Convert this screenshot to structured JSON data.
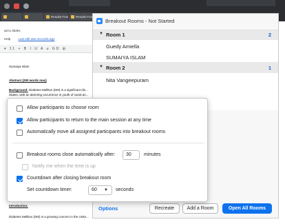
{
  "browser": {
    "top_tabs": [
      "",
      ""
    ],
    "tabs": [
      "",
      "",
      "Results From a T...",
      "Results From a T..."
    ]
  },
  "doc": {
    "link_text": "ad to Slides",
    "menu": [
      "Help"
    ],
    "last_edit": "Last edit was seconds ago",
    "toolbar": "▾ 11 + B I U A ⌀ GD ⊞",
    "author": "Sumaiya Islam",
    "abstract_heading": "Abstract (250 words max)",
    "background_label": "Background:",
    "background_text": " Diabetes Mellitus (DM) is a significant dis... States, with an alarming occurrence in youth of racial an...",
    "intro_heading": "Introduction:",
    "intro_text": "Diabetes Mellitus (DM) is a growing concern in the Unite..."
  },
  "breakout": {
    "title": "Breakout Rooms - Not Started",
    "rooms": [
      {
        "name": "Room 1",
        "count": "2",
        "participants": [
          "Guedy Amiella",
          "SUMAIYA ISLAM"
        ]
      },
      {
        "name": "Room 2",
        "count": "1",
        "participants": [
          "Nita Vangeepuram"
        ]
      }
    ],
    "options_link": "Options",
    "buttons": {
      "recreate": "Recreate",
      "add_room": "Add a Room",
      "open_all": "Open All Rooms"
    }
  },
  "options": {
    "allow_choose": {
      "label": "Allow participants to choose room",
      "checked": false
    },
    "allow_return": {
      "label": "Allow participants to return to the main session at any time",
      "checked": true
    },
    "auto_move": {
      "label": "Automatically move all assigned participants into breakout rooms",
      "checked": false
    },
    "auto_close": {
      "label": "Breakout rooms close automatically after:",
      "checked": false,
      "value": "30",
      "unit": "minutes"
    },
    "notify": {
      "label": "Notify me when the time is up",
      "checked": false
    },
    "countdown": {
      "label": "Countdown after closing breakout room",
      "checked": true
    },
    "countdown_timer": {
      "label": "Set countdown timer:",
      "value": "60",
      "unit": "seconds"
    }
  },
  "colors": {
    "accent": "#0e72ed",
    "count": "#1b5bd6"
  }
}
